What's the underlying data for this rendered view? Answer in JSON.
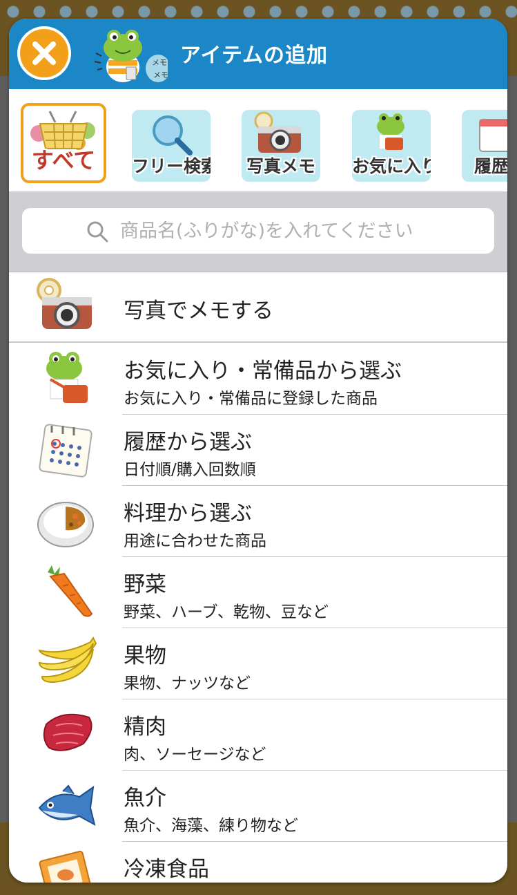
{
  "header": {
    "title": "アイテムの追加",
    "close_icon": "close-icon",
    "memo_text_1": "メモ",
    "memo_text_2": "メモ"
  },
  "tabs": [
    {
      "label": "すべて",
      "icon": "basket-icon",
      "active": true
    },
    {
      "label": "フリー検索",
      "icon": "magnifier-icon",
      "active": false
    },
    {
      "label": "写真メモ",
      "icon": "camera-icon",
      "active": false
    },
    {
      "label": "お気に入り",
      "icon": "frog-icon",
      "active": false
    },
    {
      "label": "履歴",
      "icon": "calendar-icon",
      "active": false
    }
  ],
  "search": {
    "placeholder": "商品名(ふりがな)を入れてください"
  },
  "photo_memo": {
    "label": "写真でメモする",
    "icon": "camera-icon"
  },
  "items": [
    {
      "title": "お気に入り・常備品から選ぶ",
      "subtitle": "お気に入り・常備品に登録した商品",
      "icon": "frog-icon"
    },
    {
      "title": "履歴から選ぶ",
      "subtitle": "日付順/購入回数順",
      "icon": "calendar-icon"
    },
    {
      "title": "料理から選ぶ",
      "subtitle": "用途に合わせた商品",
      "icon": "curry-icon"
    },
    {
      "title": "野菜",
      "subtitle": "野菜、ハーブ、乾物、豆など",
      "icon": "carrot-icon"
    },
    {
      "title": "果物",
      "subtitle": "果物、ナッツなど",
      "icon": "banana-icon"
    },
    {
      "title": "精肉",
      "subtitle": "肉、ソーセージなど",
      "icon": "meat-icon"
    },
    {
      "title": "魚介",
      "subtitle": "魚介、海藻、練り物など",
      "icon": "fish-icon"
    },
    {
      "title": "冷凍食品",
      "subtitle": "",
      "icon": "frozen-food-icon"
    }
  ],
  "colors": {
    "header": "#1b87c6",
    "accent": "#f2a01a",
    "tab_bg": "#bfeaf1",
    "search_bg": "#cfcfd3"
  }
}
